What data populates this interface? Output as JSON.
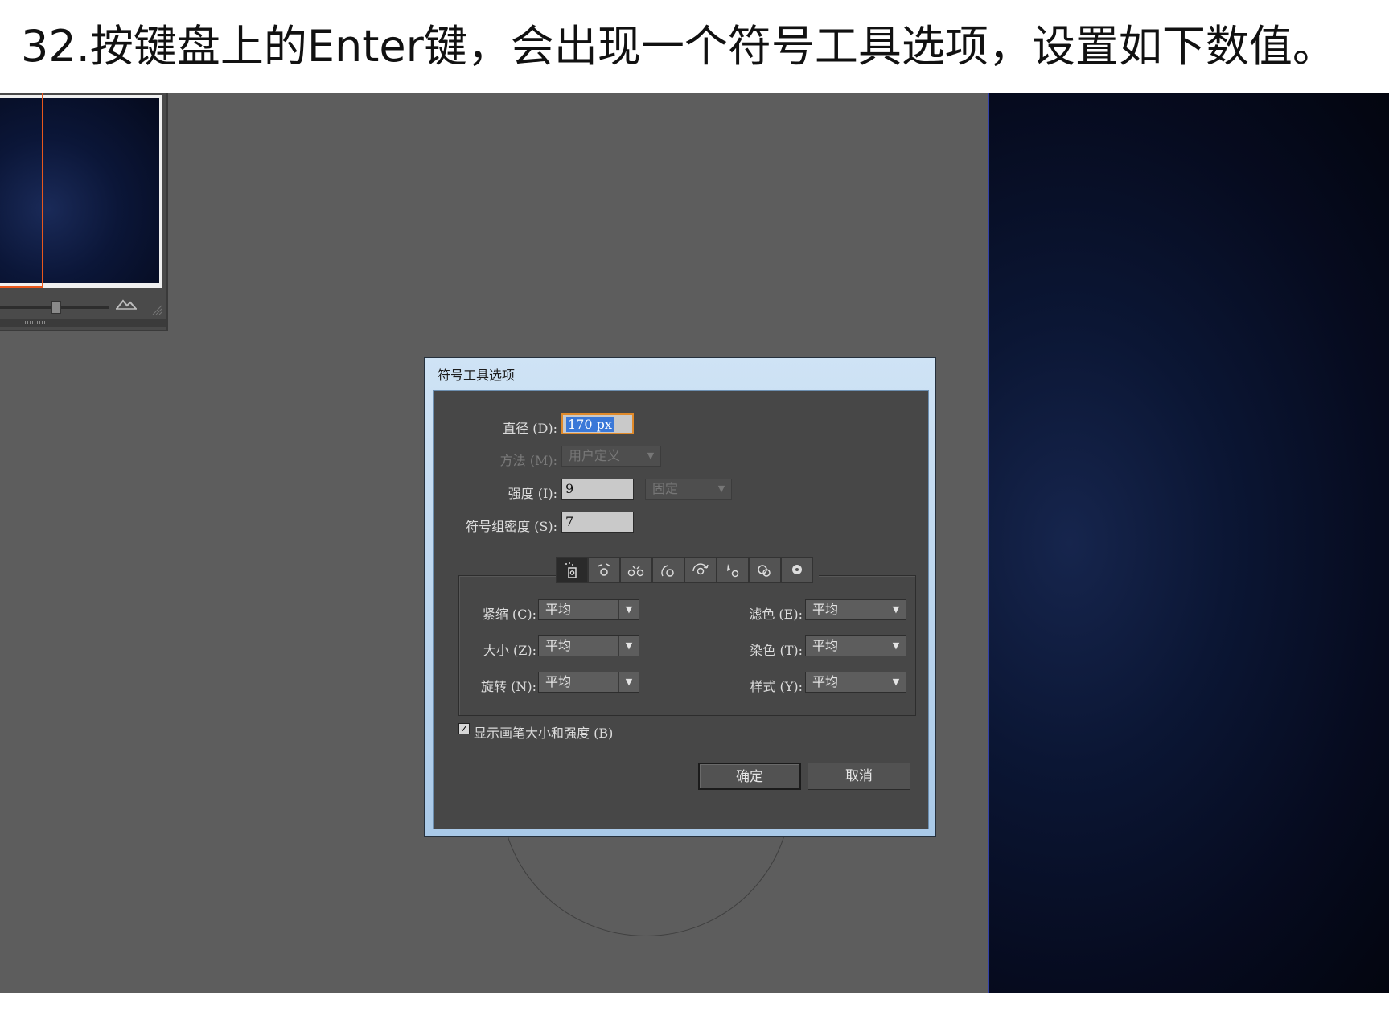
{
  "caption": "32.按键盘上的Enter键，会出现一个符号工具选项，设置如下数值。",
  "dialog": {
    "title": "符号工具选项",
    "diameter": {
      "label": "直径 (D):",
      "value": "170 px"
    },
    "method": {
      "label": "方法 (M):",
      "value": "用户定义"
    },
    "intensity": {
      "label": "强度 (I):",
      "value": "9",
      "mode": "固定"
    },
    "density": {
      "label": "符号组密度 (S):",
      "value": "7"
    },
    "tools": [
      "symbol-sprayer",
      "symbol-shifter",
      "symbol-scruncher",
      "symbol-sizer",
      "symbol-spinner",
      "symbol-stainer",
      "symbol-screener",
      "symbol-styler"
    ],
    "options": {
      "scrunch": {
        "label": "紧缩 (C):",
        "value": "平均"
      },
      "size": {
        "label": "大小 (Z):",
        "value": "平均"
      },
      "spin": {
        "label": "旋转 (N):",
        "value": "平均"
      },
      "screen": {
        "label": "滤色 (E):",
        "value": "平均"
      },
      "stain": {
        "label": "染色 (T):",
        "value": "平均"
      },
      "style": {
        "label": "样式 (Y):",
        "value": "平均"
      }
    },
    "show_brush": {
      "label": "显示画笔大小和强度 (B)",
      "checked": true,
      "mark": "✓"
    },
    "ok_label": "确定",
    "cancel_label": "取消",
    "dropdown_arrow": "▼"
  },
  "colors": {
    "workspace": "#5d5d5d",
    "dialog_body": "#474747",
    "selection": "#3a78d8",
    "navigator_view": "#e8571c"
  }
}
